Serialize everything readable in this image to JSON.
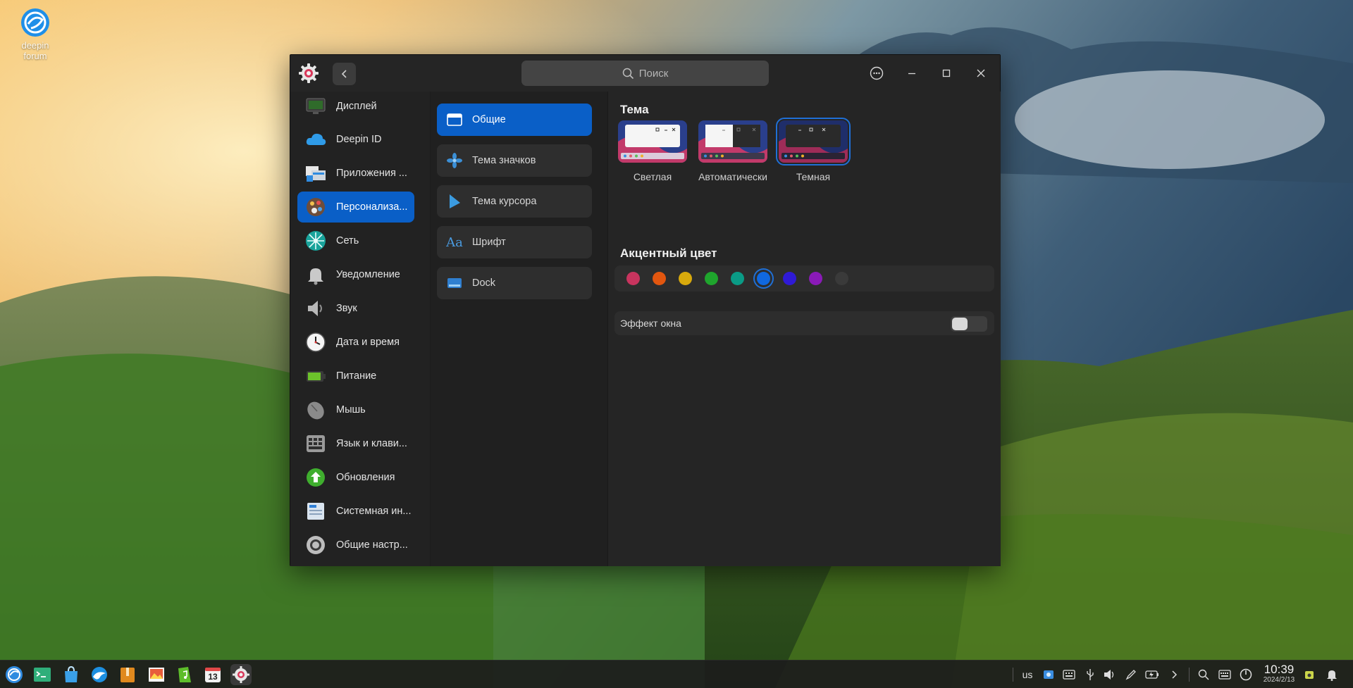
{
  "desktop": {
    "icon_label_line1": "deepin",
    "icon_label_line2": "forum"
  },
  "window": {
    "search_placeholder": "Поиск",
    "sidebar": [
      {
        "label": "Дисплей",
        "icon": "display-icon"
      },
      {
        "label": "Deepin ID",
        "icon": "cloud-icon"
      },
      {
        "label": "Приложения ...",
        "icon": "apps-icon"
      },
      {
        "label": "Персонализа...",
        "icon": "personalization-icon",
        "active": true
      },
      {
        "label": "Сеть",
        "icon": "network-icon"
      },
      {
        "label": "Уведомление",
        "icon": "bell-icon"
      },
      {
        "label": "Звук",
        "icon": "speaker-icon"
      },
      {
        "label": "Дата и время",
        "icon": "clock-icon"
      },
      {
        "label": "Питание",
        "icon": "battery-icon"
      },
      {
        "label": "Мышь",
        "icon": "mouse-icon"
      },
      {
        "label": "Язык и клави...",
        "icon": "keyboard-icon"
      },
      {
        "label": "Обновления",
        "icon": "update-icon"
      },
      {
        "label": "Системная ин...",
        "icon": "system-info-icon"
      },
      {
        "label": "Общие настр...",
        "icon": "general-settings-icon"
      }
    ],
    "subnav": [
      {
        "label": "Общие",
        "icon": "window-icon",
        "active": true
      },
      {
        "label": "Тема значков",
        "icon": "icon-theme-icon"
      },
      {
        "label": "Тема курсора",
        "icon": "cursor-icon"
      },
      {
        "label": "Шрифт",
        "icon": "font-icon"
      },
      {
        "label": "Dock",
        "icon": "dock-icon"
      }
    ],
    "content": {
      "theme_heading": "Тема",
      "themes": [
        {
          "label": "Светлая",
          "selected": false
        },
        {
          "label": "Автоматически",
          "selected": false
        },
        {
          "label": "Темная",
          "selected": true
        }
      ],
      "accent_heading": "Акцентный цвет",
      "accent_colors": [
        "#c8345e",
        "#e2560f",
        "#d8a90c",
        "#1fa52d",
        "#0a9b86",
        "#1068e0",
        "#2f1ad6",
        "#8a1ab8",
        "#3a3a3a"
      ],
      "accent_selected_index": 5,
      "window_effect_label": "Эффект окна",
      "window_effect_enabled": false
    }
  },
  "taskbar": {
    "keyboard_layout": "us",
    "time": "10:39",
    "date": "2024/2/13",
    "calendar_day": "13"
  },
  "colors": {
    "accent": "#0a5fc7",
    "window_bg": "#252525"
  }
}
